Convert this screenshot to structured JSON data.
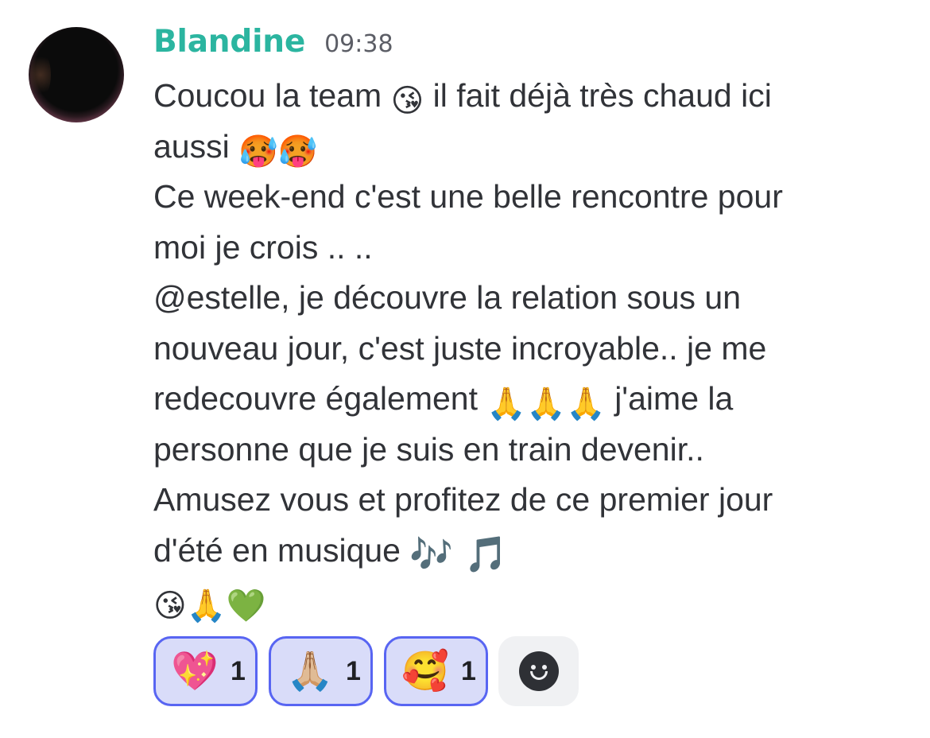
{
  "message": {
    "author": "Blandine",
    "timestamp": "09:38",
    "lines": [
      {
        "text_before": "Coucou la team ",
        "emoji": "😘",
        "text_after": " il fait déjà très chaud ici"
      },
      {
        "text_before": "aussi ",
        "emoji": "🥵🥵",
        "text_after": ""
      },
      {
        "text_before": "Ce week-end c'est une belle rencontre pour",
        "emoji": "",
        "text_after": ""
      },
      {
        "text_before": "moi je crois .. ..",
        "emoji": "",
        "text_after": ""
      },
      {
        "text_before": "@estelle, je découvre la relation sous un",
        "emoji": "",
        "text_after": ""
      },
      {
        "text_before": "nouveau jour, c'est juste incroyable.. je me",
        "emoji": "",
        "text_after": ""
      },
      {
        "text_before": "redecouvre également ",
        "emoji": "🙏🙏🙏",
        "text_after": " j'aime la"
      },
      {
        "text_before": "personne que je suis en train devenir..",
        "emoji": "",
        "text_after": ""
      },
      {
        "text_before": "Amusez vous et profitez de ce premier jour",
        "emoji": "",
        "text_after": ""
      },
      {
        "text_before": "d'été en musique ",
        "emoji": "🎶 🎵",
        "text_after": ""
      },
      {
        "text_before": "",
        "emoji": "😘🙏💚",
        "text_after": ""
      }
    ]
  },
  "reactions": [
    {
      "emoji": "💖",
      "count": "1"
    },
    {
      "emoji": "🙏🏼",
      "count": "1"
    },
    {
      "emoji": "🥰",
      "count": "1"
    }
  ],
  "add_reaction_icon": "smiley-face-icon",
  "colors": {
    "username": "#2bb5a0",
    "reaction_border": "#5865f2",
    "reaction_bg": "#d9dcf9"
  }
}
